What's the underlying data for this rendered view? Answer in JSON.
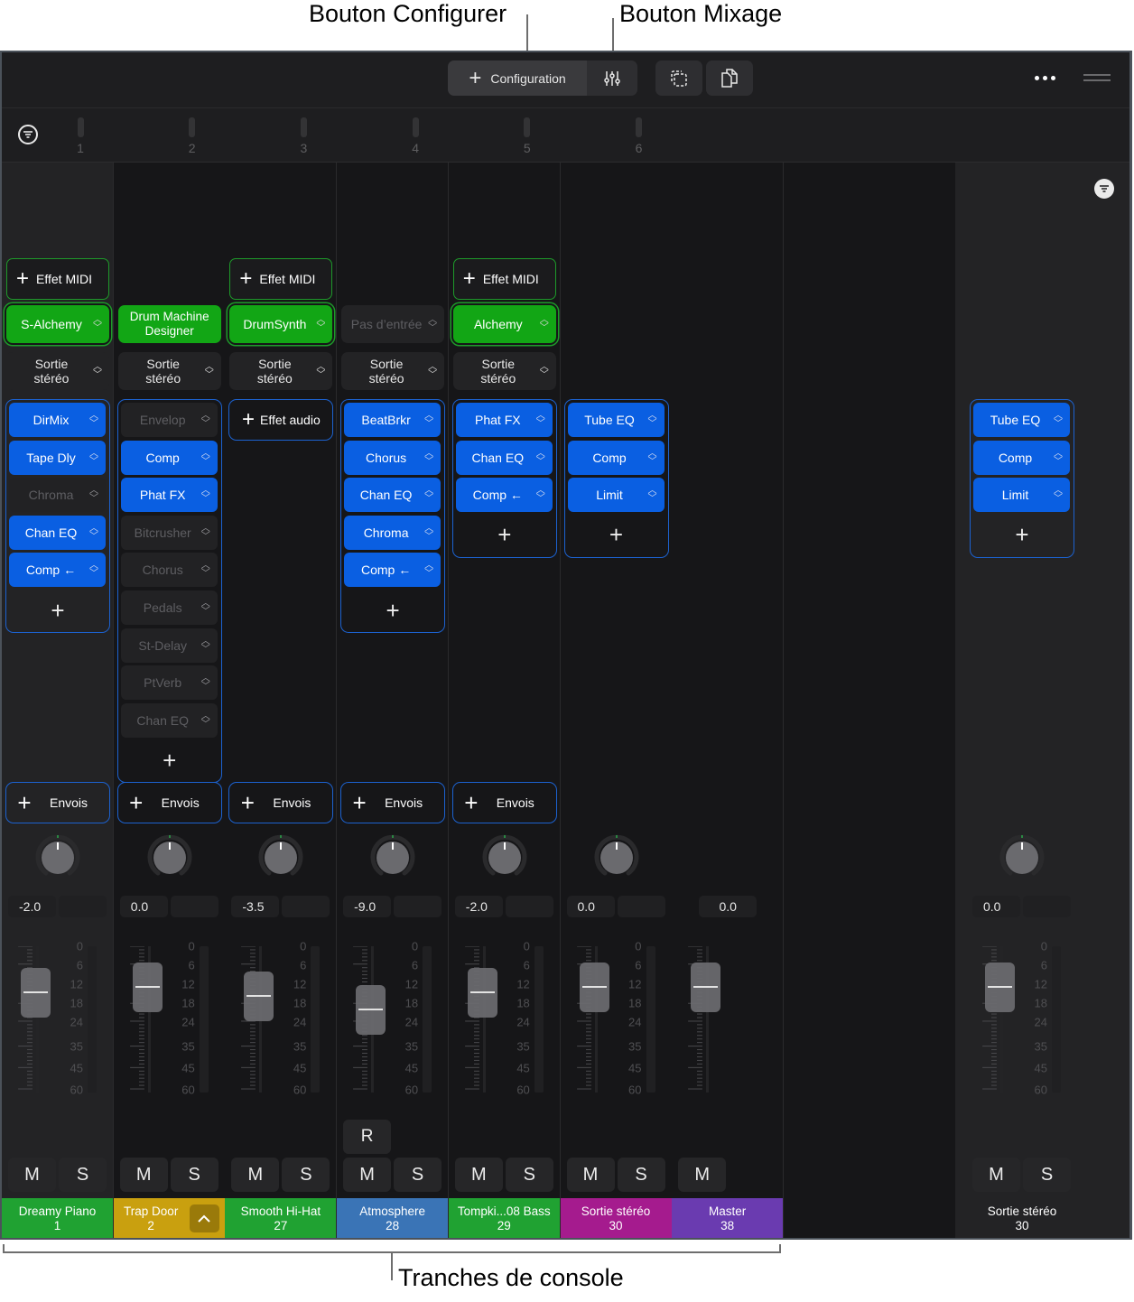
{
  "callouts": {
    "configure_button": "Bouton Configurer",
    "mix_button": "Bouton Mixage",
    "channel_strips": "Tranches de console"
  },
  "toolbar": {
    "configuration_label": "Configuration",
    "icons": {
      "configuration": "plus-icon",
      "mix": "sliders-icon",
      "select": "dashed-selection-icon",
      "copy": "copy-document-icon",
      "more": "ellipsis-icon",
      "handle": "drag-handle-icon"
    }
  },
  "ruler": {
    "filter_icon": "filter-icon",
    "markers": [
      "1",
      "2",
      "3",
      "4",
      "5",
      "6"
    ]
  },
  "colors": {
    "instrument_green": "#12a615",
    "plugin_blue": "#0a5fe2",
    "midi_border": "#1e9a2a",
    "group_border": "#1c62d0"
  },
  "db_scale": [
    "0",
    "6",
    "12",
    "18",
    "24",
    "35",
    "45",
    "60"
  ],
  "labels": {
    "midi_fx": "Effet MIDI",
    "audio_fx": "Effet audio",
    "sends": "Envois",
    "mute": "M",
    "solo": "S",
    "record": "R",
    "output_line1": "Sortie",
    "output_line2": "stéréo"
  },
  "strips": [
    {
      "name": "Dreamy Piano",
      "number": "1",
      "color": "#20a232",
      "midi_fx": true,
      "instrument": "S-Alchemy",
      "output": true,
      "effects": [
        {
          "name": "DirMix",
          "active": true
        },
        {
          "name": "Tape Dly",
          "active": true
        },
        {
          "name": "Chroma",
          "active": false
        },
        {
          "name": "Chan EQ",
          "active": true
        },
        {
          "name": "Comp ←",
          "active": true
        }
      ],
      "volume": "-2.0",
      "fader_db": -2.0,
      "has_solo": true
    },
    {
      "name": "Trap Door",
      "number": "2",
      "color": "#c9a00f",
      "midi_fx": false,
      "instrument": "Drum Machine Designer",
      "output": true,
      "effects": [
        {
          "name": "Envelop",
          "active": false
        },
        {
          "name": "Comp",
          "active": true
        },
        {
          "name": "Phat FX",
          "active": true
        },
        {
          "name": "Bitcrusher",
          "active": false
        },
        {
          "name": "Chorus",
          "active": false
        },
        {
          "name": "Pedals",
          "active": false
        },
        {
          "name": "St-Delay",
          "active": false
        },
        {
          "name": "PtVerb",
          "active": false
        },
        {
          "name": "Chan EQ",
          "active": false
        }
      ],
      "volume": "0.0",
      "fader_db": 0.0,
      "has_solo": true
    },
    {
      "name": "Smooth Hi-Hat",
      "number": "27",
      "color": "#20a232",
      "midi_fx": true,
      "instrument": "DrumSynth",
      "output": true,
      "effects": [],
      "volume": "-3.5",
      "fader_db": -3.5,
      "has_solo": true
    },
    {
      "name": "Atmosphere",
      "number": "28",
      "color": "#3a74b6",
      "midi_fx": false,
      "instrument": "Pas d’entrée",
      "output": true,
      "effects": [
        {
          "name": "BeatBrkr",
          "active": true
        },
        {
          "name": "Chorus",
          "active": true
        },
        {
          "name": "Chan EQ",
          "active": true
        },
        {
          "name": "Chroma",
          "active": true
        },
        {
          "name": "Comp ←",
          "active": true
        }
      ],
      "volume": "-9.0",
      "fader_db": -9.0,
      "has_solo": true,
      "has_record": true
    },
    {
      "name": "Tompki...08 Bass",
      "number": "29",
      "color": "#20a232",
      "midi_fx": true,
      "instrument": "Alchemy",
      "output": true,
      "effects": [
        {
          "name": "Phat FX",
          "active": true
        },
        {
          "name": "Chan EQ",
          "active": true
        },
        {
          "name": "Comp ←",
          "active": true
        }
      ],
      "volume": "-2.0",
      "fader_db": -2.0,
      "has_solo": true
    },
    {
      "name": "Sortie stéréo",
      "number": "30",
      "color": "#a51b8e",
      "midi_fx": false,
      "instrument": null,
      "output": false,
      "effects": [
        {
          "name": "Tube EQ",
          "active": true
        },
        {
          "name": "Comp",
          "active": true
        },
        {
          "name": "Limit",
          "active": true
        }
      ],
      "volume": "0.0",
      "fader_db": 0.0,
      "has_solo": true,
      "no_sends": true
    },
    {
      "name": "Master",
      "number": "38",
      "color": "#6a3bb0",
      "midi_fx": false,
      "instrument": null,
      "output": false,
      "effects": null,
      "volume": "0.0",
      "fader_db": 0.0,
      "has_solo": false,
      "no_sends": true,
      "no_pan": true
    }
  ],
  "output_strip": {
    "name": "Sortie stéréo",
    "number": "30",
    "effects": [
      {
        "name": "Tube EQ",
        "active": true
      },
      {
        "name": "Comp",
        "active": true
      },
      {
        "name": "Limit",
        "active": true
      }
    ],
    "volume": "0.0",
    "fader_db": 0.0
  }
}
